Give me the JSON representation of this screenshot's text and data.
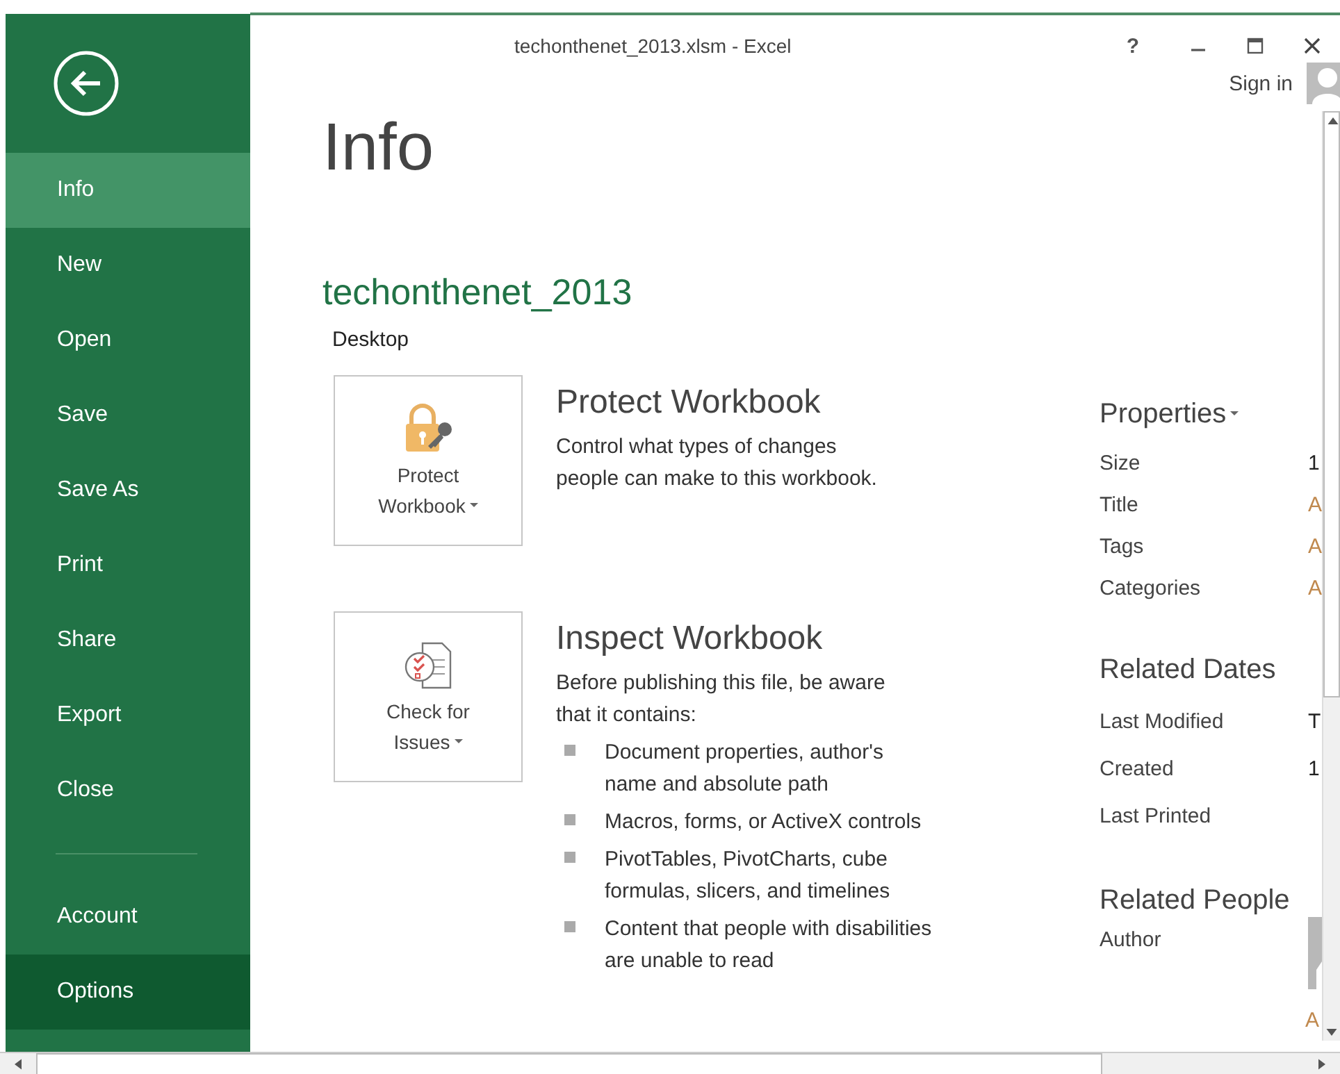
{
  "window": {
    "title": "techonthenet_2013.xlsm - Excel",
    "help": "?"
  },
  "account": {
    "label": "Sign in"
  },
  "sidebar": {
    "items": [
      {
        "label": "Info",
        "selected": true,
        "hovered": false
      },
      {
        "label": "New",
        "selected": false,
        "hovered": false
      },
      {
        "label": "Open",
        "selected": false,
        "hovered": false
      },
      {
        "label": "Save",
        "selected": false,
        "hovered": false
      },
      {
        "label": "Save As",
        "selected": false,
        "hovered": false
      },
      {
        "label": "Print",
        "selected": false,
        "hovered": false
      },
      {
        "label": "Share",
        "selected": false,
        "hovered": false
      },
      {
        "label": "Export",
        "selected": false,
        "hovered": false
      },
      {
        "label": "Close",
        "selected": false,
        "hovered": false
      }
    ],
    "bottom_items": [
      {
        "label": "Account",
        "selected": false,
        "hovered": false
      },
      {
        "label": "Options",
        "selected": false,
        "hovered": true
      }
    ]
  },
  "page": {
    "heading": "Info",
    "file_name": "techonthenet_2013",
    "location": "Desktop"
  },
  "sections": [
    {
      "kind": "protect",
      "button": {
        "lines": [
          "Protect",
          "Workbook"
        ],
        "dropdown": true
      },
      "title": "Protect Workbook",
      "description": "Control what types of changes people can make to this workbook."
    },
    {
      "kind": "inspect",
      "button": {
        "lines": [
          "Check for",
          "Issues"
        ],
        "dropdown": true
      },
      "title": "Inspect Workbook",
      "description": "Before publishing this file, be aware that it contains:",
      "bullets": [
        "Document properties, author's name and absolute path",
        "Macros, forms, or ActiveX controls",
        "PivotTables, PivotCharts, cube formulas, slicers, and timelines",
        "Content that people with disabilities are unable to read"
      ]
    }
  ],
  "properties": {
    "title": "Properties",
    "dropdown": true,
    "rows": [
      {
        "label": "Size",
        "value": "1",
        "placeholder": false
      },
      {
        "label": "Title",
        "value": "A",
        "placeholder": true
      },
      {
        "label": "Tags",
        "value": "A",
        "placeholder": true
      },
      {
        "label": "Categories",
        "value": "A",
        "placeholder": true
      }
    ]
  },
  "related_dates": {
    "title": "Related Dates",
    "rows": [
      {
        "label": "Last Modified",
        "value": "T",
        "placeholder": false
      },
      {
        "label": "Created",
        "value": "1",
        "placeholder": false
      },
      {
        "label": "Last Printed"
      }
    ]
  },
  "related_people": {
    "title": "Related People",
    "rows": [
      {
        "label": "Author",
        "avatar": true
      }
    ],
    "trailing": "A"
  }
}
